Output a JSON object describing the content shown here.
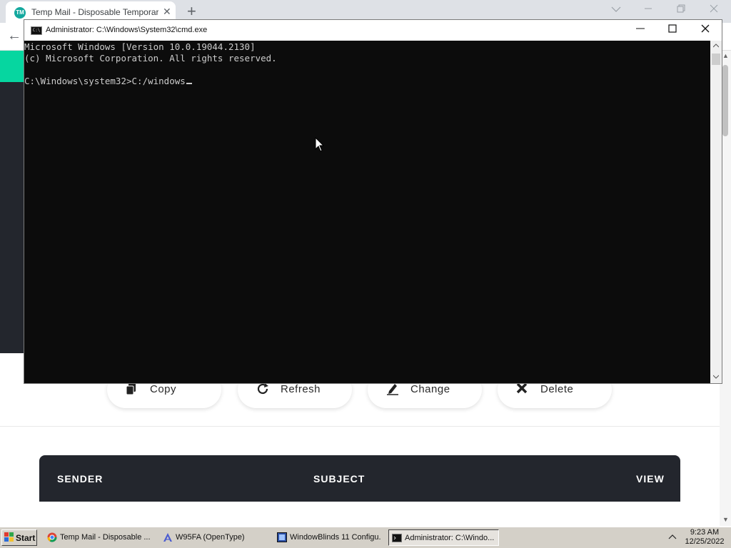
{
  "browser": {
    "tab_title": "Temp Mail - Disposable Temporary Email",
    "tab_favicon_text": "TM",
    "tab_close": "✕",
    "new_tab": "+",
    "back": "←"
  },
  "page": {
    "actions": [
      {
        "label": "Copy",
        "icon": "copy-icon"
      },
      {
        "label": "Refresh",
        "icon": "refresh-icon"
      },
      {
        "label": "Change",
        "icon": "edit-icon"
      },
      {
        "label": "Delete",
        "icon": "delete-icon"
      }
    ],
    "table_headers": {
      "sender": "SENDER",
      "subject": "SUBJECT",
      "view": "VIEW"
    },
    "colors": {
      "accent": "#06d6a0",
      "dark": "#23262d"
    }
  },
  "cmd": {
    "title": "Administrator: C:\\Windows\\System32\\cmd.exe",
    "lines": [
      "Microsoft Windows [Version 10.0.19044.2130]",
      "(c) Microsoft Corporation. All rights reserved.",
      "",
      "C:\\Windows\\system32>C:/windows"
    ],
    "colors": {
      "background": "#0c0c0c",
      "text": "#cccccc"
    }
  },
  "taskbar": {
    "start_label": "Start",
    "tasks": [
      {
        "label": "Temp Mail - Disposable ...",
        "icon": "chrome-icon",
        "active": false
      },
      {
        "label": "W95FA (OpenType)",
        "icon": "font-icon",
        "active": false
      },
      {
        "label": "WindowBlinds 11 Configu...",
        "icon": "windowblinds-icon",
        "active": false
      },
      {
        "label": "Administrator: C:\\Windo...",
        "icon": "cmd-icon",
        "active": true
      }
    ],
    "time": "9:23 AM",
    "date": "12/25/2022"
  }
}
